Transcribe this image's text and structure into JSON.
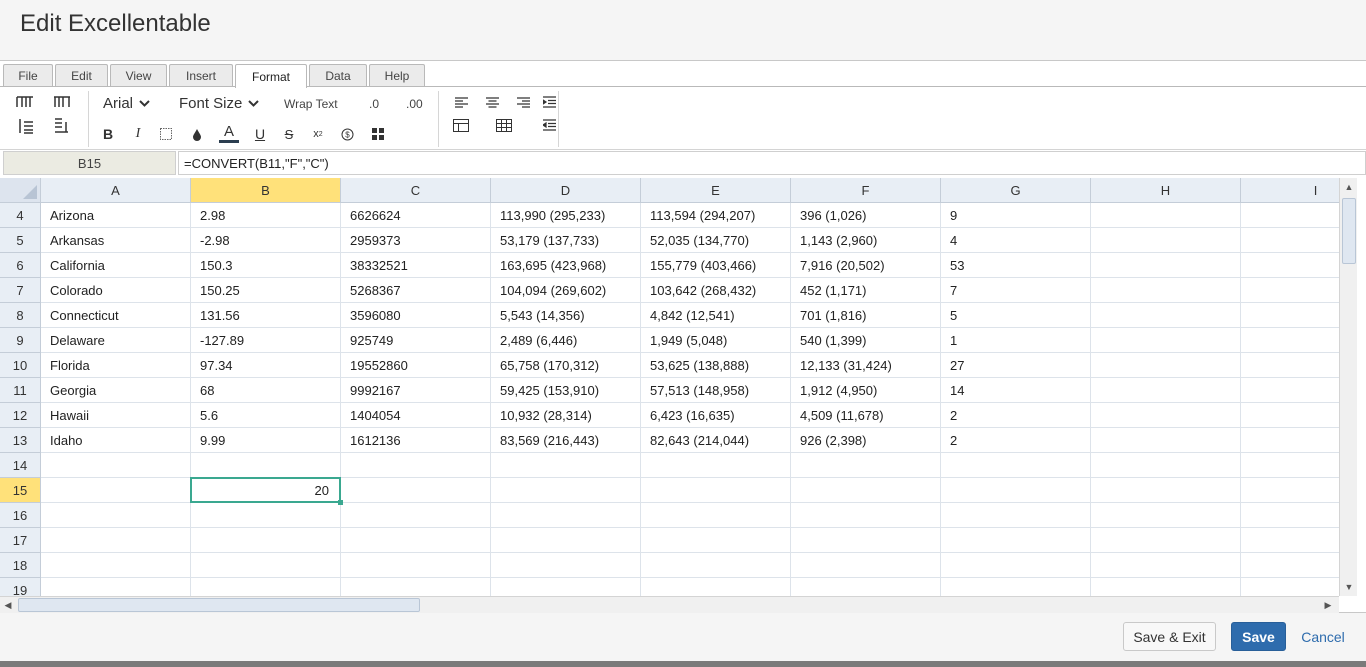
{
  "dialog": {
    "title": "Edit Excellentable"
  },
  "ribbon": {
    "tabs": [
      "File",
      "Edit",
      "View",
      "Insert",
      "Format",
      "Data",
      "Help"
    ],
    "active_tab": "Format",
    "font_family": "Arial",
    "font_size_label": "Font Size",
    "wrap_text": "Wrap Text",
    "decimal_decrease": ".0",
    "decimal_increase": ".00",
    "bold": "B",
    "italic": "I",
    "underline": "U",
    "strike": "S",
    "superscript": "x",
    "font_color": "A",
    "currency": "$"
  },
  "formula_bar": {
    "cell_ref": "B15",
    "formula": "=CONVERT(B11,\"F\",\"C\")"
  },
  "grid": {
    "columns": [
      "A",
      "B",
      "C",
      "D",
      "E",
      "F",
      "G",
      "H",
      "I"
    ],
    "selected_column": "B",
    "selected_row": "15",
    "rows": [
      {
        "num": "4",
        "cells": [
          "Arizona",
          "2.98",
          "6626624",
          "113,990 (295,233)",
          "113,594 (294,207)",
          "396 (1,026)",
          "9",
          "",
          ""
        ]
      },
      {
        "num": "5",
        "cells": [
          "Arkansas",
          "-2.98",
          "2959373",
          "53,179 (137,733)",
          "52,035 (134,770)",
          "1,143 (2,960)",
          "4",
          "",
          ""
        ]
      },
      {
        "num": "6",
        "cells": [
          "California",
          "150.3",
          "38332521",
          "163,695 (423,968)",
          "155,779 (403,466)",
          "7,916 (20,502)",
          "53",
          "",
          ""
        ]
      },
      {
        "num": "7",
        "cells": [
          "Colorado",
          "150.25",
          "5268367",
          "104,094 (269,602)",
          "103,642 (268,432)",
          "452 (1,171)",
          "7",
          "",
          ""
        ]
      },
      {
        "num": "8",
        "cells": [
          "Connecticut",
          "131.56",
          "3596080",
          "5,543 (14,356)",
          "4,842 (12,541)",
          "701 (1,816)",
          "5",
          "",
          ""
        ]
      },
      {
        "num": "9",
        "cells": [
          "Delaware",
          "-127.89",
          "925749",
          "2,489 (6,446)",
          "1,949 (5,048)",
          "540 (1,399)",
          "1",
          "",
          ""
        ]
      },
      {
        "num": "10",
        "cells": [
          "Florida",
          "97.34",
          "19552860",
          "65,758 (170,312)",
          "53,625 (138,888)",
          "12,133 (31,424)",
          "27",
          "",
          ""
        ]
      },
      {
        "num": "11",
        "cells": [
          "Georgia",
          "68",
          "9992167",
          "59,425 (153,910)",
          "57,513 (148,958)",
          "1,912 (4,950)",
          "14",
          "",
          ""
        ]
      },
      {
        "num": "12",
        "cells": [
          "Hawaii",
          "5.6",
          "1404054",
          "10,932 (28,314)",
          "6,423 (16,635)",
          "4,509 (11,678)",
          "2",
          "",
          ""
        ]
      },
      {
        "num": "13",
        "cells": [
          "Idaho",
          "9.99",
          "1612136",
          "83,569 (216,443)",
          "82,643 (214,044)",
          "926 (2,398)",
          "2",
          "",
          ""
        ]
      },
      {
        "num": "14",
        "cells": [
          "",
          "",
          "",
          "",
          "",
          "",
          "",
          "",
          ""
        ]
      },
      {
        "num": "15",
        "cells": [
          "",
          "",
          "",
          "",
          "",
          "",
          "",
          "",
          ""
        ]
      },
      {
        "num": "16",
        "cells": [
          "",
          "",
          "",
          "",
          "",
          "",
          "",
          "",
          ""
        ]
      },
      {
        "num": "17",
        "cells": [
          "",
          "",
          "",
          "",
          "",
          "",
          "",
          "",
          ""
        ]
      },
      {
        "num": "18",
        "cells": [
          "",
          "",
          "",
          "",
          "",
          "",
          "",
          "",
          ""
        ]
      },
      {
        "num": "19",
        "cells": [
          "",
          "",
          "",
          "",
          "",
          "",
          "",
          "",
          ""
        ]
      }
    ],
    "active_cell_value": "20"
  },
  "footer": {
    "save_exit": "Save & Exit",
    "save": "Save",
    "cancel": "Cancel"
  }
}
